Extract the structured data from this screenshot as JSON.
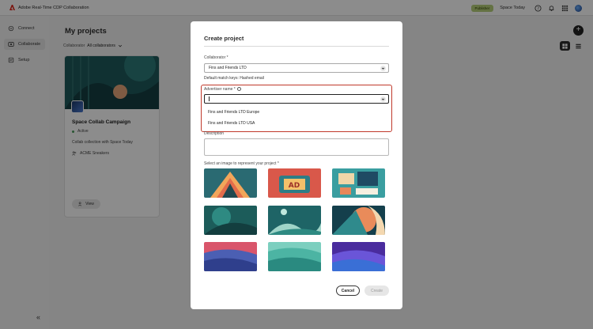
{
  "topbar": {
    "app_title": "Adobe Real-Time CDP Collaboration",
    "badge": "Publisher",
    "org": "Space Today"
  },
  "sidenav": {
    "items": [
      {
        "label": "Connect"
      },
      {
        "label": "Collaborate"
      },
      {
        "label": "Setup"
      }
    ],
    "collapse_glyph": "«"
  },
  "main": {
    "title": "My projects",
    "filter_label": "Collaborator",
    "filter_value": "All collaborators",
    "add_glyph": "+"
  },
  "card": {
    "title": "Space Collab Campaign",
    "status": "Active",
    "description": "Collab collection with Space Today",
    "member": "ACME Sneakers",
    "view_label": "View"
  },
  "modal": {
    "title": "Create project",
    "collaborator_label": "Collaborator",
    "required_mark": "*",
    "collaborator_value": "Fins and Friends LTD",
    "match_keys": "Default match keys: Hashed email",
    "advertiser_label": "Advertiser name",
    "advertiser_options": [
      "Fins and Friends LTD Europe",
      "Fins and Friends LTD USA"
    ],
    "description_label": "Description",
    "image_label": "Select an image to represent your project",
    "cancel_label": "Cancel",
    "create_label": "Create"
  },
  "colors": {
    "highlight": "#c0392b",
    "publisher_badge": "#b6cf7a",
    "active_dot": "#4e9e5e"
  }
}
